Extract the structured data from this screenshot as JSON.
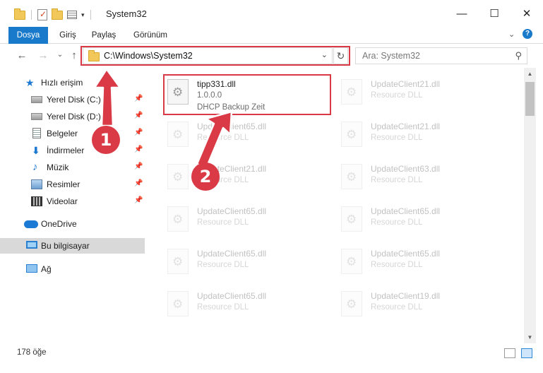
{
  "window": {
    "title": "System32",
    "controls": {
      "minimize": "—",
      "maximize": "☐",
      "close": "✕"
    }
  },
  "ribbon": {
    "tabs": [
      "Dosya",
      "Giriş",
      "Paylaş",
      "Görünüm"
    ],
    "expand_glyph": "⌄",
    "help_glyph": "?"
  },
  "address": {
    "back": "←",
    "forward": "→",
    "recent": "⌄",
    "up": "↑",
    "path": "C:\\Windows\\System32",
    "dropdown": "⌄",
    "refresh": "↻",
    "search_placeholder": "Ara: System32",
    "search_icon": "⚲"
  },
  "sidebar": {
    "pin_glyph": "📌",
    "items": [
      {
        "label": "Hızlı erişim",
        "icon": "star-icon"
      },
      {
        "label": "Yerel Disk (C:)",
        "icon": "drive-icon",
        "pinned": true
      },
      {
        "label": "Yerel Disk (D:)",
        "icon": "drive-icon",
        "pinned": true
      },
      {
        "label": "Belgeler",
        "icon": "documents-icon",
        "pinned": true
      },
      {
        "label": "İndirmeler",
        "icon": "download-icon",
        "pinned": true
      },
      {
        "label": "Müzik",
        "icon": "music-icon",
        "pinned": true
      },
      {
        "label": "Resimler",
        "icon": "pictures-icon",
        "pinned": true
      },
      {
        "label": "Videolar",
        "icon": "videos-icon",
        "pinned": true
      },
      {
        "label": "OneDrive",
        "icon": "cloud-icon"
      },
      {
        "label": "Bu bilgisayar",
        "icon": "computer-icon",
        "selected": true
      },
      {
        "label": "Ağ",
        "icon": "network-icon"
      }
    ]
  },
  "files": [
    {
      "name": "tipp331.dll",
      "line1": "1.0.0.0",
      "line2": "DHCP Backup Zeit",
      "highlighted": true
    },
    {
      "name": "UpdateClient21.dll",
      "line1": "Resource DLL"
    },
    {
      "name": "UpdateClient65.dll",
      "line1": "Resource DLL"
    },
    {
      "name": "UpdateClient21.dll",
      "line1": "Resource DLL"
    },
    {
      "name": "UpdateClient21.dll",
      "line1": "Resource DLL"
    },
    {
      "name": "UpdateClient63.dll",
      "line1": "Resource DLL"
    },
    {
      "name": "UpdateClient65.dll",
      "line1": "Resource DLL"
    },
    {
      "name": "UpdateClient65.dll",
      "line1": "Resource DLL"
    },
    {
      "name": "UpdateClient65.dll",
      "line1": "Resource DLL"
    },
    {
      "name": "UpdateClient65.dll",
      "line1": "Resource DLL"
    },
    {
      "name": "UpdateClient65.dll",
      "line1": "Resource DLL"
    },
    {
      "name": "UpdateClient19.dll",
      "line1": "Resource DLL"
    }
  ],
  "status": {
    "item_count": "178 öğe"
  },
  "annotations": {
    "step1": "1",
    "step2": "2",
    "color": "#d93a45"
  },
  "colors": {
    "accent": "#1979ca",
    "highlight": "#d93a45",
    "selection": "#d9d9d9"
  }
}
